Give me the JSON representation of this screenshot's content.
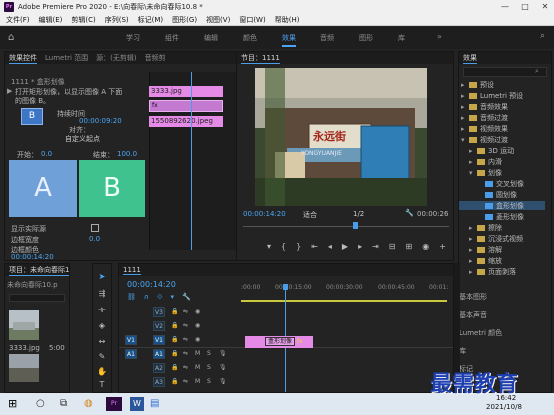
{
  "titlebar": {
    "title": "Adobe Premiere Pro 2020 - E:\\向春际\\未命向春际10.8 *",
    "min": "—",
    "max": "□",
    "close": "✕"
  },
  "menu": [
    "文件(F)",
    "编辑(E)",
    "剪辑(C)",
    "序列(S)",
    "标记(M)",
    "图形(G)",
    "视图(V)",
    "窗口(W)",
    "帮助(H)"
  ],
  "workspaces": [
    "学习",
    "组件",
    "编辑",
    "颜色",
    "效果",
    "音频",
    "图形",
    "库"
  ],
  "workspace_active": "效果",
  "effect_controls": {
    "tabs": [
      "效果控件",
      "Lumetri 范围",
      "源：(无剪辑)",
      "音频剪"
    ],
    "seq_label": "1111 * 盒形划像",
    "desc_line1": "打开矩形划像，以显示图像 A 下面",
    "desc_line2": "的图像 B。",
    "duration_label": "持续时间",
    "duration_value": "00:00:09:20",
    "align_label": "对齐：",
    "align_value": "自定义起点",
    "start_label": "开始：",
    "start_value": "0.0",
    "end_label": "结束：",
    "end_value": "100.0",
    "thumb_a": "A",
    "thumb_b": "B",
    "show_actual": "显示实际源",
    "border_width": "边框宽度",
    "border_width_value": "0.0",
    "border_color": "边框颜色",
    "timecode": "00:00:14:20",
    "clip1": "3333.jpg",
    "clip2": "1550892620.jpeg",
    "clip_label": "fx"
  },
  "program_monitor": {
    "title": "节目：1111",
    "timecode_left": "00:00:14:20",
    "fit": "适合",
    "resolution": "1/2",
    "timecode_right": "00:00:26",
    "sign_text": "永远街",
    "sign_sub": "YONGYUANJIE"
  },
  "effects_panel": {
    "title": "效果",
    "search_placeholder": "",
    "items": [
      {
        "label": "预设",
        "level": 0,
        "open": false
      },
      {
        "label": "Lumetri 预设",
        "level": 0,
        "open": false
      },
      {
        "label": "音频效果",
        "level": 0,
        "open": false
      },
      {
        "label": "音频过渡",
        "level": 0,
        "open": false
      },
      {
        "label": "视频效果",
        "level": 0,
        "open": false
      },
      {
        "label": "视频过渡",
        "level": 0,
        "open": true
      },
      {
        "label": "3D 运动",
        "level": 1,
        "open": false
      },
      {
        "label": "内滑",
        "level": 1,
        "open": false
      },
      {
        "label": "划像",
        "level": 1,
        "open": true
      },
      {
        "label": "交叉划像",
        "level": 2,
        "open": false
      },
      {
        "label": "圆划像",
        "level": 2,
        "open": false
      },
      {
        "label": "盒形划像",
        "level": 2,
        "open": false
      },
      {
        "label": "菱形划像",
        "level": 2,
        "open": false
      },
      {
        "label": "擦除",
        "level": 1,
        "open": false
      },
      {
        "label": "沉浸式视频",
        "level": 1,
        "open": false
      },
      {
        "label": "溶解",
        "level": 1,
        "open": false
      },
      {
        "label": "缩放",
        "level": 1,
        "open": false
      },
      {
        "label": "页面剥落",
        "level": 1,
        "open": false
      }
    ],
    "sections": [
      "基本图形",
      "基本声音",
      "Lumetri 颜色",
      "库",
      "标记"
    ]
  },
  "project": {
    "title": "项目：未命向春际10",
    "file": "未命向春际10.p",
    "items": [
      {
        "name": "3333.jpg",
        "dur": "5:00"
      },
      {
        "name": "",
        "dur": ""
      }
    ]
  },
  "timeline": {
    "title": "1111",
    "timecode": "00:00:14:20",
    "ruler": [
      ":00:00",
      "00:00:15:00",
      "00:00:30:00",
      "00:00:45:00",
      "00:01:"
    ],
    "video_tracks": [
      "V3",
      "V2",
      "V1"
    ],
    "audio_tracks": [
      "A1",
      "A2",
      "A3"
    ],
    "source_patch": [
      "V1",
      "A1"
    ],
    "clip_label": "盒形划像"
  },
  "taskbar": {
    "time": "16:42",
    "date": "2021/10/8"
  },
  "watermark": "最需教育",
  "colors": {
    "accent": "#4fa2f5",
    "clip_pink": "#e58ae6",
    "thumb_a": "#6fa0d8",
    "thumb_b": "#3fc28e"
  }
}
